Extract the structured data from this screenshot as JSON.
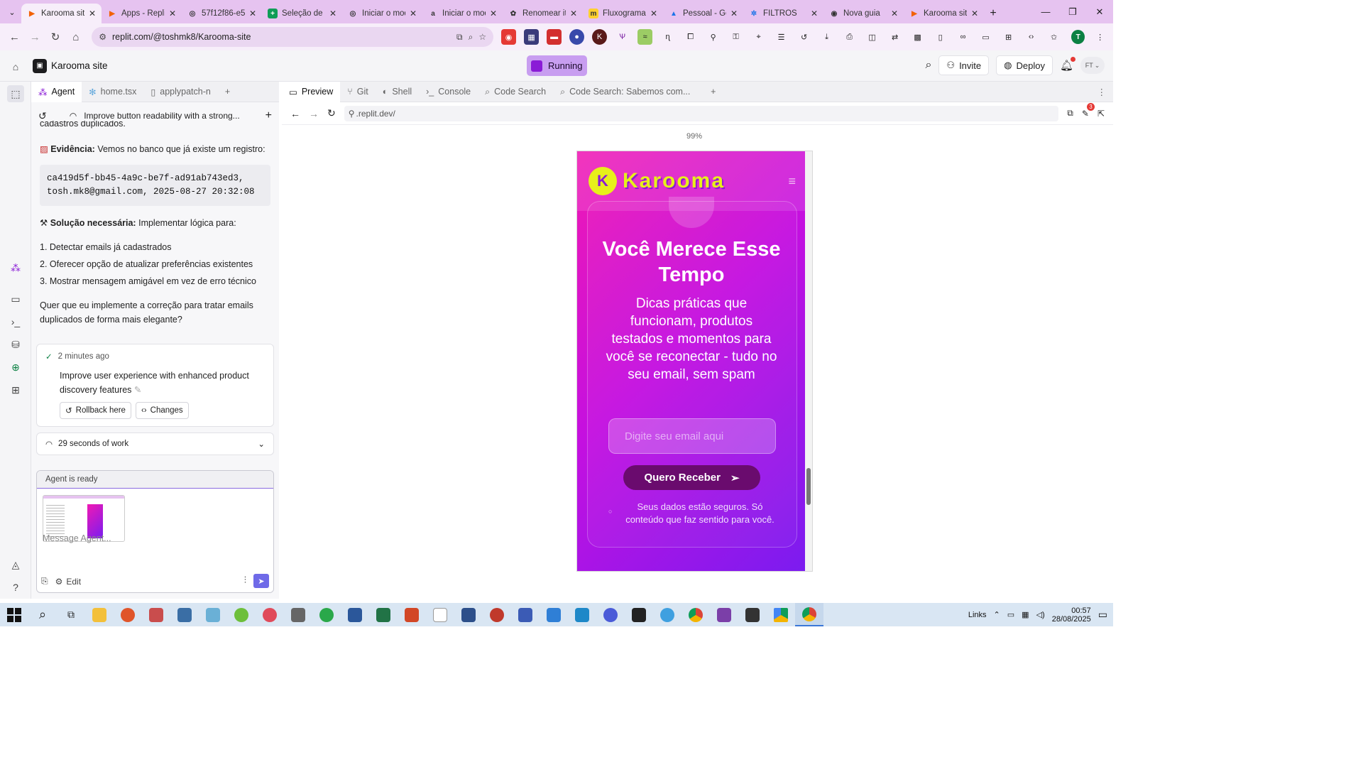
{
  "browser": {
    "tabs": [
      {
        "title": "Karooma site",
        "icon": "replit-icon",
        "active": true
      },
      {
        "title": "Apps - Replit",
        "icon": "replit-icon"
      },
      {
        "title": "57f12f86-e5",
        "icon": "globe-icon"
      },
      {
        "title": "Seleção de P",
        "icon": "sheets-icon"
      },
      {
        "title": "Iniciar o mod",
        "icon": "globe-icon"
      },
      {
        "title": "Iniciar o mod",
        "icon": "amazon-icon"
      },
      {
        "title": "Renomear it",
        "icon": "chatgpt-icon"
      },
      {
        "title": "Fluxograma",
        "icon": "miro-icon"
      },
      {
        "title": "Pessoal - Go",
        "icon": "drive-icon"
      },
      {
        "title": "FILTROS",
        "icon": "filter-icon"
      },
      {
        "title": "Nova guia",
        "icon": "chrome-icon"
      },
      {
        "title": "Karooma site",
        "icon": "replit-icon"
      }
    ],
    "url": "replit.com/@toshmk8/Karooma-site",
    "profile_initial": "T"
  },
  "app": {
    "name": "Karooma site",
    "run_status": "Running",
    "invite_label": "Invite",
    "deploy_label": "Deploy",
    "avatar_initials": "FT"
  },
  "left_tabs": [
    {
      "label": "Agent",
      "active": true
    },
    {
      "label": "home.tsx"
    },
    {
      "label": "applypatch-n"
    }
  ],
  "right_tabs": [
    {
      "label": "Preview",
      "active": true
    },
    {
      "label": "Git"
    },
    {
      "label": "Shell"
    },
    {
      "label": "Console"
    },
    {
      "label": "Code Search"
    },
    {
      "label": "Code Search: Sabemos com..."
    }
  ],
  "agent": {
    "thread_title": "Improve button readability with a strong...",
    "cut_text": "cadastros duplicados.",
    "evidence_label": "Evidência:",
    "evidence_text": "Vemos no banco que já existe um registro:",
    "code_line1": "ca419d5f-bb45-4a9c-be7f-ad91ab743ed3,",
    "code_line2": "tosh.mk8@gmail.com, 2025-08-27 20:32:08",
    "solution_label": "Solução necessária:",
    "solution_text": "Implementar lógica para:",
    "steps": [
      "1. Detectar emails já cadastrados",
      "2. Oferecer opção de atualizar preferências existentes",
      "3. Mostrar mensagem amigável em vez de erro técnico"
    ],
    "question": "Quer que eu implemente a correção para tratar emails duplicados de forma mais elegante?",
    "checkpoint_time": "2 minutes ago",
    "checkpoint_text": "Improve user experience with enhanced product discovery features",
    "rollback_label": "Rollback here",
    "changes_label": "Changes",
    "work_label": "29 seconds of work",
    "ready_label": "Agent is ready",
    "input_placeholder": "Message Agent...",
    "edit_label": "Edit"
  },
  "preview": {
    "url": ".replit.dev/",
    "zoom": "99%",
    "notif_count": "3",
    "site": {
      "brand": "Karooma",
      "title": "Você Merece Esse Tempo",
      "subtitle": "Dicas práticas que funcionam, produtos testados e momentos para você se reconectar - tudo no seu email, sem spam",
      "email_placeholder": "Digite seu email aqui",
      "cta": "Quero Receber",
      "safe_text": "Seus dados estão seguros. Só conteúdo que faz sentido para você."
    }
  },
  "taskbar": {
    "links_label": "Links",
    "time": "00:57",
    "date": "28/08/2025"
  },
  "colors": {
    "tab_bar": "#e6c3f0",
    "accent": "#8a1bd6",
    "running_bg": "#c89ef0",
    "karooma_pink": "#f019b4",
    "karooma_purple": "#7a1cf0",
    "karooma_yellow": "#e7f01a"
  }
}
